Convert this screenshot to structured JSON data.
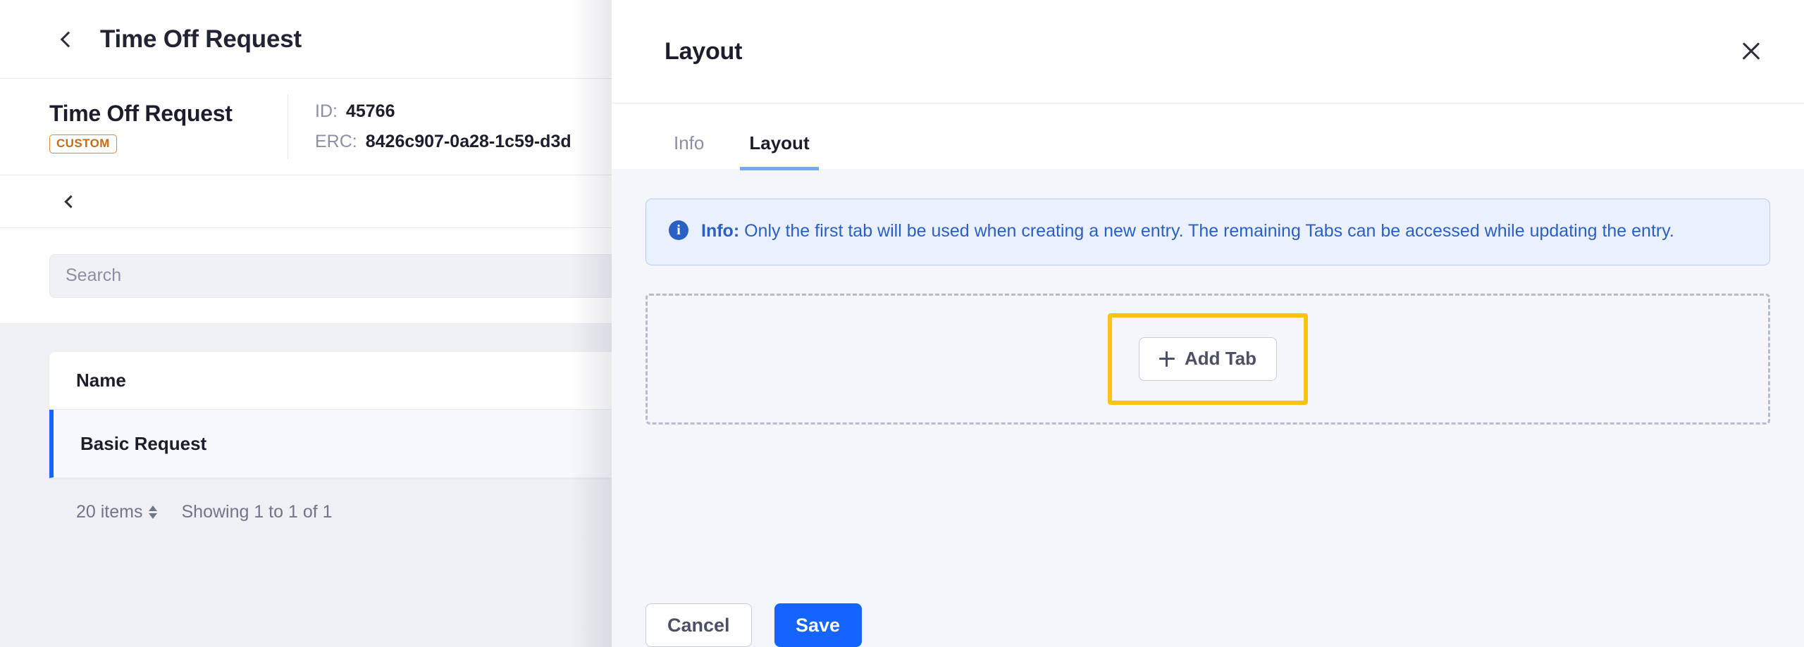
{
  "topbar": {
    "back_label": "back",
    "title": "Time Off Request",
    "apps_icon": "grid-icon",
    "avatar_icon": "user-avatar"
  },
  "entity": {
    "name": "Time Off Request",
    "badge": "CUSTOM",
    "id_label": "ID:",
    "id_value": "45766",
    "erc_label": "ERC:",
    "erc_value": "8426c907-0a28-1c59-d3d"
  },
  "list_panel": {
    "search": {
      "value": "",
      "placeholder": "Search"
    },
    "table": {
      "columns": [
        "Name"
      ],
      "rows": [
        {
          "name": "Basic Request",
          "selected": true
        }
      ]
    },
    "pagination": {
      "page_size": "20 items",
      "showing": "Showing 1 to 1 of 1"
    }
  },
  "drawer": {
    "title": "Layout",
    "close_icon": "close-icon",
    "tabs": [
      {
        "label": "Info",
        "active": false
      },
      {
        "label": "Layout",
        "active": true
      }
    ],
    "info_banner": {
      "icon": "info-icon",
      "prefix": "Info:",
      "message": "Only the first tab will be used when creating a new entry. The remaining Tabs can be accessed while updating the entry."
    },
    "add_tab_button": {
      "label": "Add Tab",
      "icon": "plus-icon",
      "highlighted": true
    },
    "footer": {
      "cancel_label": "Cancel",
      "save_label": "Save"
    }
  },
  "colors": {
    "accent_blue": "#1464ff",
    "highlight_yellow": "#fec215",
    "badge_orange": "#c96a12",
    "info_blue": "#2a5fc4",
    "avatar_pink": "#ff72bd"
  }
}
